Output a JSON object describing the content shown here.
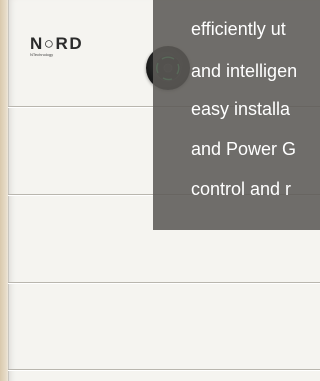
{
  "brand": {
    "name": "N○RD",
    "tagline": "NTechnology"
  },
  "overlay": {
    "lines": [
      "efficiently ut",
      "and intelligen",
      "easy installa",
      "and Power G",
      "control and r"
    ]
  },
  "icons": {
    "controller": "power-button-icon"
  },
  "colors": {
    "overlay_bg": "#5c5a57",
    "product_body": "#f5f4f0",
    "indicator": "#3fd36b"
  }
}
